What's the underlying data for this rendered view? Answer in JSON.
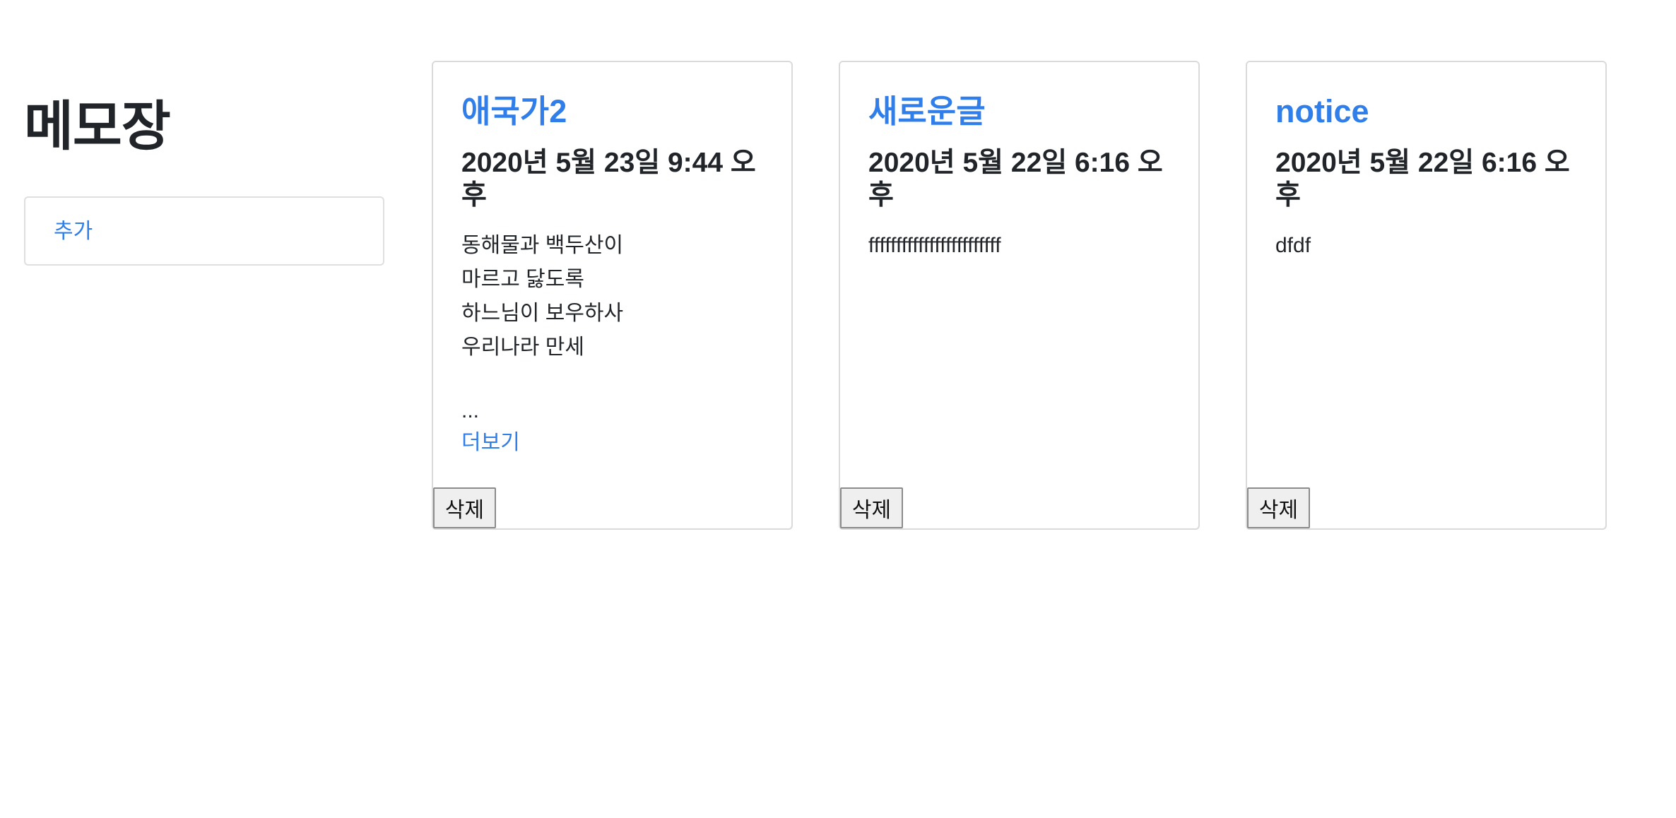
{
  "header": {
    "title": "메모장"
  },
  "sidebar": {
    "add_label": "추가"
  },
  "memos": [
    {
      "title": "애국가2",
      "date": "2020년 5월 23일 9:44 오후",
      "lines": [
        "동해물과 백두산이",
        "마르고 닳도록",
        "하느님이 보우하사",
        "우리나라 만세"
      ],
      "ellipsis": "...",
      "more_label": "더보기",
      "delete_label": "삭제"
    },
    {
      "title": "새로운글",
      "date": "2020년 5월 22일 6:16 오후",
      "lines": [
        "ffffffffffffffffffffffff"
      ],
      "delete_label": "삭제"
    },
    {
      "title": "notice",
      "date": "2020년 5월 22일 6:16 오후",
      "lines": [
        "dfdf"
      ],
      "delete_label": "삭제"
    }
  ],
  "colors": {
    "accent": "#2f7eea",
    "text": "#212529",
    "border": "#dadada",
    "button_bg": "#efefef"
  }
}
